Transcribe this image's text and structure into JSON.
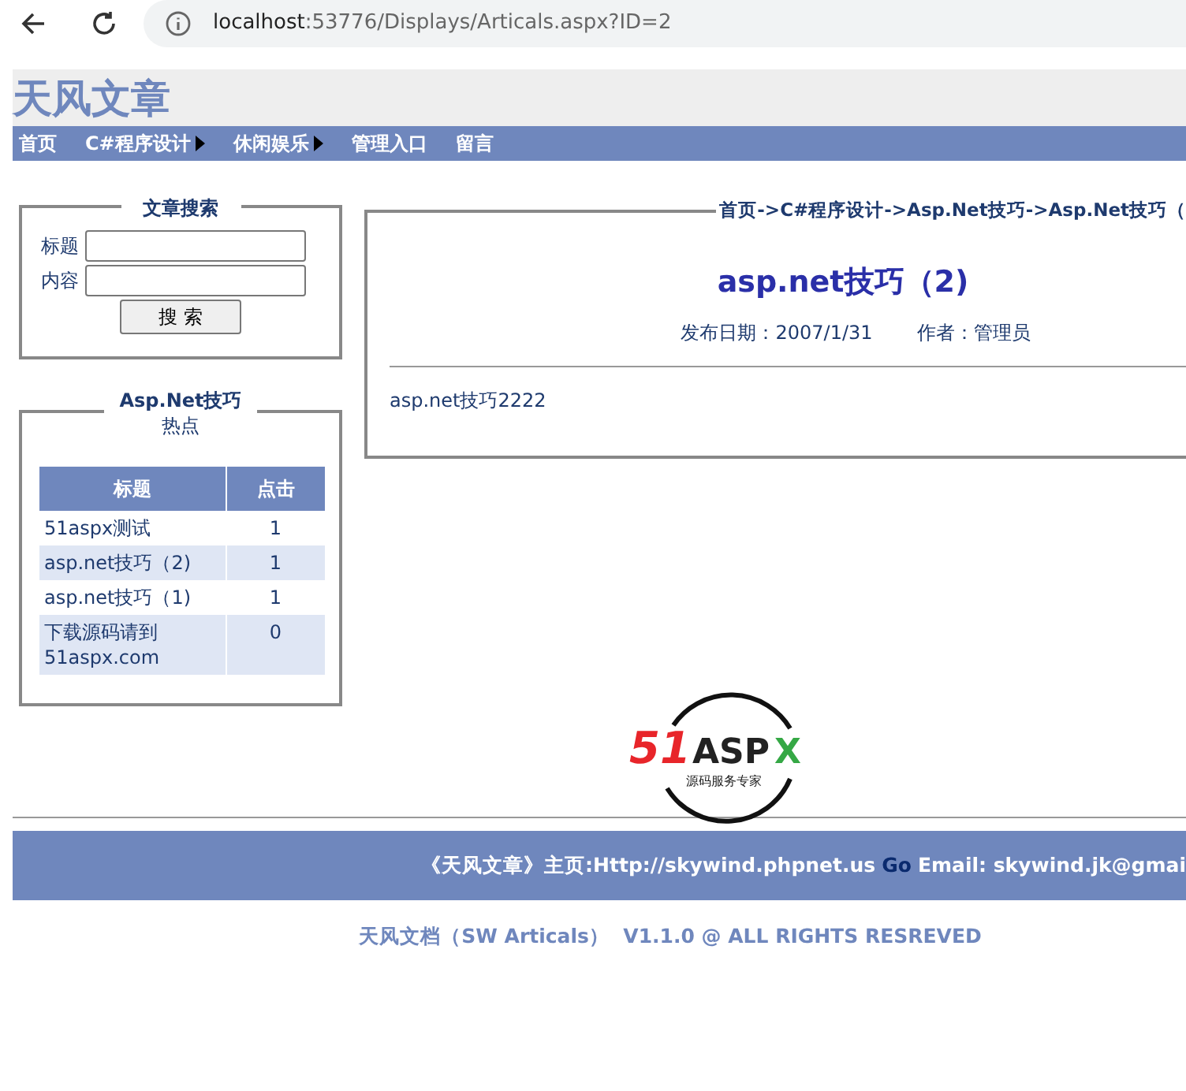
{
  "browser": {
    "url_host": "localhost",
    "url_rest": ":53776/Displays/Articals.aspx?ID=2"
  },
  "site_title": "天风文章",
  "nav": [
    {
      "label": "首页",
      "submenu": false
    },
    {
      "label": "C#程序设计",
      "submenu": true
    },
    {
      "label": "休闲娱乐",
      "submenu": true
    },
    {
      "label": "管理入口",
      "submenu": false
    },
    {
      "label": "留言",
      "submenu": false
    }
  ],
  "search": {
    "title": "文章搜索",
    "fields": [
      {
        "label": "标题"
      },
      {
        "label": "内容"
      }
    ],
    "button": "搜 索"
  },
  "hot": {
    "title": "Asp.Net技巧",
    "subtitle": "热点",
    "columns": [
      "标题",
      "点击"
    ],
    "rows": [
      {
        "title": "51aspx测试",
        "clicks": "1"
      },
      {
        "title": "asp.net技巧（2)",
        "clicks": "1"
      },
      {
        "title": "asp.net技巧（1)",
        "clicks": "1"
      },
      {
        "title": "下载源码请到51aspx.com",
        "clicks": "0"
      }
    ]
  },
  "article": {
    "breadcrumb": "首页->C#程序设计->Asp.Net技巧->Asp.Net技巧（",
    "title": "asp.net技巧（2)",
    "date": "发布日期：2007/1/31",
    "author": "作者：管理员",
    "body": "asp.net技巧2222"
  },
  "logo": {
    "brand_red": "51",
    "brand_dark": "ASP",
    "brand_green": "X",
    "tagline": "源码服务专家"
  },
  "footer": {
    "site": "《天风文章》主页:Http://skywind.phpnet.us",
    "go": "Go",
    "email": "Email: skywind.jk@gmai",
    "copyright": "天风文档（SW Articals）  V1.1.0 @ ALL RIGHTS RESREVED"
  }
}
